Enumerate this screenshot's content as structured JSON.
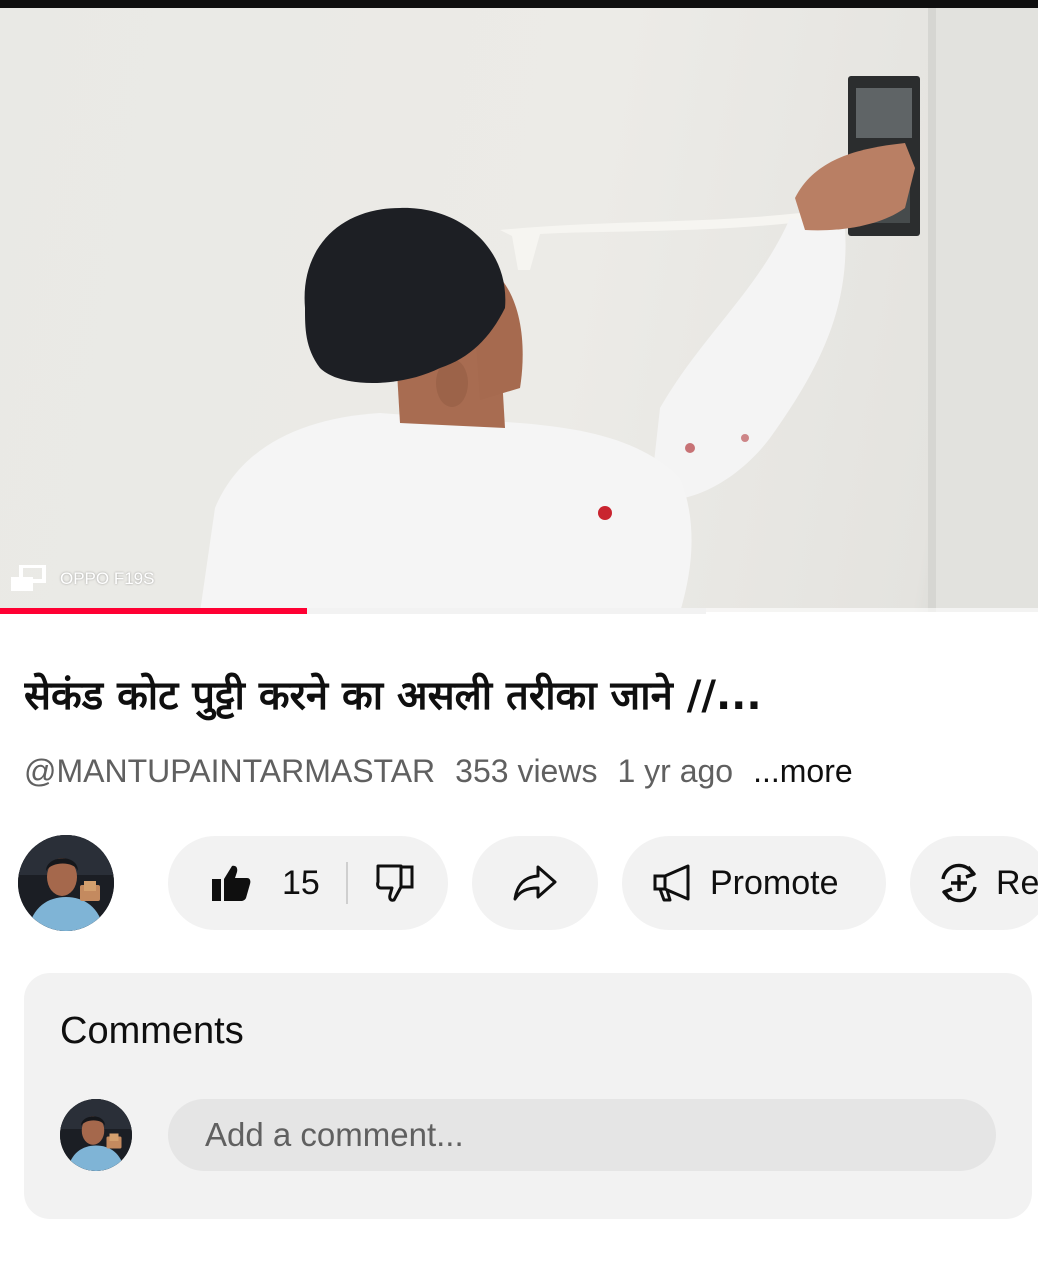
{
  "player": {
    "watermark_text": "OPPO F19S",
    "progress": {
      "played_fraction": 0.296,
      "buffered_fraction": 0.68
    },
    "colors": {
      "played": "#ff0033"
    }
  },
  "video": {
    "title": "सेकंड कोट पुट्टी करने का असली तरीका जाने //...",
    "channel_handle": "@MANTUPAINTARMASTAR",
    "views": "353 views",
    "age": "1 yr ago",
    "more_label": "...more"
  },
  "actions": {
    "like_icon": "thumbs-up-icon",
    "like_count": "15",
    "dislike_icon": "thumbs-down-icon",
    "share_icon": "share-arrow-icon",
    "promote_icon": "megaphone-icon",
    "promote_label": "Promote",
    "remix_icon": "remix-icon",
    "remix_label": "Re"
  },
  "comments": {
    "title": "Comments",
    "input_placeholder": "Add a comment..."
  }
}
